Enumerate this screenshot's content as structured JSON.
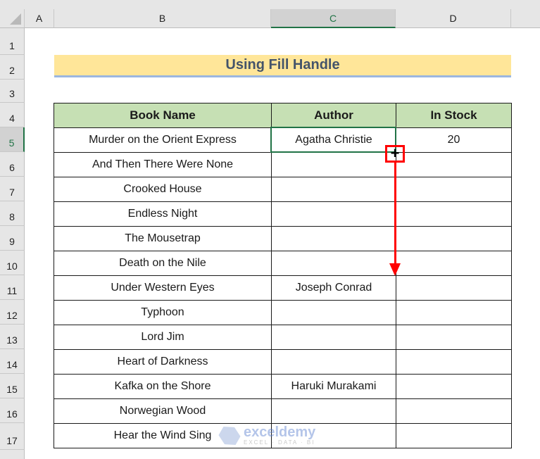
{
  "columns": [
    "A",
    "B",
    "C",
    "D"
  ],
  "selected_column": "C",
  "rows": [
    "1",
    "2",
    "3",
    "4",
    "5",
    "6",
    "7",
    "8",
    "9",
    "10",
    "11",
    "12",
    "13",
    "14",
    "15",
    "16",
    "17"
  ],
  "selected_row": "5",
  "title": "Using Fill Handle",
  "table": {
    "headers": [
      "Book Name",
      "Author",
      "In Stock"
    ],
    "rows": [
      [
        "Murder on the Orient Express",
        "Agatha Christie",
        "20"
      ],
      [
        "And Then There Were None",
        "",
        ""
      ],
      [
        "Crooked House",
        "",
        ""
      ],
      [
        "Endless Night",
        "",
        ""
      ],
      [
        "The Mousetrap",
        "",
        ""
      ],
      [
        "Death on the Nile",
        "",
        ""
      ],
      [
        "Under Western Eyes",
        "Joseph Conrad",
        ""
      ],
      [
        "Typhoon",
        "",
        ""
      ],
      [
        "Lord Jim",
        "",
        ""
      ],
      [
        "Heart of Darkness",
        "",
        ""
      ],
      [
        "Kafka on the Shore",
        "Haruki Murakami",
        ""
      ],
      [
        "Norwegian Wood",
        "",
        ""
      ],
      [
        "Hear the Wind Sing",
        "",
        ""
      ]
    ]
  },
  "annotation": {
    "fill_handle_icon": "plus-crosshair-icon",
    "arrow_direction": "down",
    "highlight_color": "#ff0000"
  },
  "watermark": {
    "brand": "exceldemy",
    "tagline": "EXCEL · DATA · BI"
  },
  "colors": {
    "accent": "#217346",
    "title_fill": "#ffe699",
    "title_text": "#44546a",
    "header_fill": "#c6e0b4"
  }
}
